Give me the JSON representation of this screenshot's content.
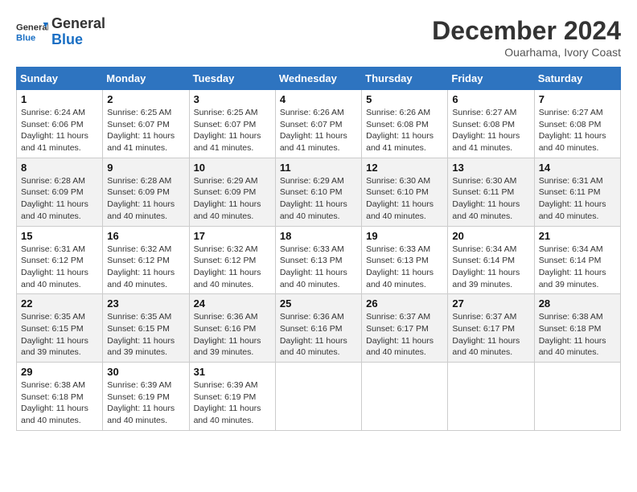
{
  "header": {
    "logo_line1": "General",
    "logo_line2": "Blue",
    "month_year": "December 2024",
    "location": "Ouarhama, Ivory Coast"
  },
  "weekdays": [
    "Sunday",
    "Monday",
    "Tuesday",
    "Wednesday",
    "Thursday",
    "Friday",
    "Saturday"
  ],
  "weeks": [
    [
      {
        "day": "1",
        "info": "Sunrise: 6:24 AM\nSunset: 6:06 PM\nDaylight: 11 hours and 41 minutes."
      },
      {
        "day": "2",
        "info": "Sunrise: 6:25 AM\nSunset: 6:07 PM\nDaylight: 11 hours and 41 minutes."
      },
      {
        "day": "3",
        "info": "Sunrise: 6:25 AM\nSunset: 6:07 PM\nDaylight: 11 hours and 41 minutes."
      },
      {
        "day": "4",
        "info": "Sunrise: 6:26 AM\nSunset: 6:07 PM\nDaylight: 11 hours and 41 minutes."
      },
      {
        "day": "5",
        "info": "Sunrise: 6:26 AM\nSunset: 6:08 PM\nDaylight: 11 hours and 41 minutes."
      },
      {
        "day": "6",
        "info": "Sunrise: 6:27 AM\nSunset: 6:08 PM\nDaylight: 11 hours and 41 minutes."
      },
      {
        "day": "7",
        "info": "Sunrise: 6:27 AM\nSunset: 6:08 PM\nDaylight: 11 hours and 40 minutes."
      }
    ],
    [
      {
        "day": "8",
        "info": "Sunrise: 6:28 AM\nSunset: 6:09 PM\nDaylight: 11 hours and 40 minutes."
      },
      {
        "day": "9",
        "info": "Sunrise: 6:28 AM\nSunset: 6:09 PM\nDaylight: 11 hours and 40 minutes."
      },
      {
        "day": "10",
        "info": "Sunrise: 6:29 AM\nSunset: 6:09 PM\nDaylight: 11 hours and 40 minutes."
      },
      {
        "day": "11",
        "info": "Sunrise: 6:29 AM\nSunset: 6:10 PM\nDaylight: 11 hours and 40 minutes."
      },
      {
        "day": "12",
        "info": "Sunrise: 6:30 AM\nSunset: 6:10 PM\nDaylight: 11 hours and 40 minutes."
      },
      {
        "day": "13",
        "info": "Sunrise: 6:30 AM\nSunset: 6:11 PM\nDaylight: 11 hours and 40 minutes."
      },
      {
        "day": "14",
        "info": "Sunrise: 6:31 AM\nSunset: 6:11 PM\nDaylight: 11 hours and 40 minutes."
      }
    ],
    [
      {
        "day": "15",
        "info": "Sunrise: 6:31 AM\nSunset: 6:12 PM\nDaylight: 11 hours and 40 minutes."
      },
      {
        "day": "16",
        "info": "Sunrise: 6:32 AM\nSunset: 6:12 PM\nDaylight: 11 hours and 40 minutes."
      },
      {
        "day": "17",
        "info": "Sunrise: 6:32 AM\nSunset: 6:12 PM\nDaylight: 11 hours and 40 minutes."
      },
      {
        "day": "18",
        "info": "Sunrise: 6:33 AM\nSunset: 6:13 PM\nDaylight: 11 hours and 40 minutes."
      },
      {
        "day": "19",
        "info": "Sunrise: 6:33 AM\nSunset: 6:13 PM\nDaylight: 11 hours and 40 minutes."
      },
      {
        "day": "20",
        "info": "Sunrise: 6:34 AM\nSunset: 6:14 PM\nDaylight: 11 hours and 39 minutes."
      },
      {
        "day": "21",
        "info": "Sunrise: 6:34 AM\nSunset: 6:14 PM\nDaylight: 11 hours and 39 minutes."
      }
    ],
    [
      {
        "day": "22",
        "info": "Sunrise: 6:35 AM\nSunset: 6:15 PM\nDaylight: 11 hours and 39 minutes."
      },
      {
        "day": "23",
        "info": "Sunrise: 6:35 AM\nSunset: 6:15 PM\nDaylight: 11 hours and 39 minutes."
      },
      {
        "day": "24",
        "info": "Sunrise: 6:36 AM\nSunset: 6:16 PM\nDaylight: 11 hours and 39 minutes."
      },
      {
        "day": "25",
        "info": "Sunrise: 6:36 AM\nSunset: 6:16 PM\nDaylight: 11 hours and 40 minutes."
      },
      {
        "day": "26",
        "info": "Sunrise: 6:37 AM\nSunset: 6:17 PM\nDaylight: 11 hours and 40 minutes."
      },
      {
        "day": "27",
        "info": "Sunrise: 6:37 AM\nSunset: 6:17 PM\nDaylight: 11 hours and 40 minutes."
      },
      {
        "day": "28",
        "info": "Sunrise: 6:38 AM\nSunset: 6:18 PM\nDaylight: 11 hours and 40 minutes."
      }
    ],
    [
      {
        "day": "29",
        "info": "Sunrise: 6:38 AM\nSunset: 6:18 PM\nDaylight: 11 hours and 40 minutes."
      },
      {
        "day": "30",
        "info": "Sunrise: 6:39 AM\nSunset: 6:19 PM\nDaylight: 11 hours and 40 minutes."
      },
      {
        "day": "31",
        "info": "Sunrise: 6:39 AM\nSunset: 6:19 PM\nDaylight: 11 hours and 40 minutes."
      },
      null,
      null,
      null,
      null
    ]
  ]
}
